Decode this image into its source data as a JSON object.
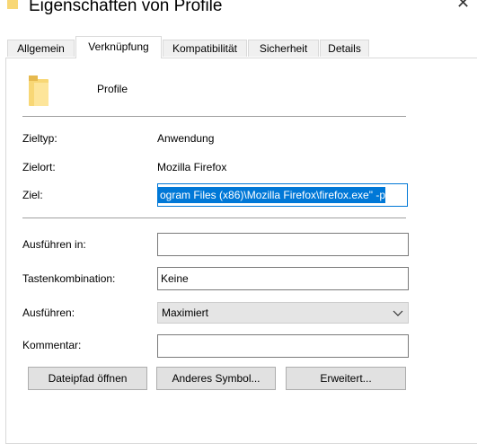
{
  "window": {
    "title": "Eigenschaften von Profile",
    "close_glyph": "✕"
  },
  "tabs": [
    {
      "label": "Allgemein",
      "active": false
    },
    {
      "label": "Verknüpfung",
      "active": true
    },
    {
      "label": "Kompatibilität",
      "active": false
    },
    {
      "label": "Sicherheit",
      "active": false
    },
    {
      "label": "Details",
      "active": false
    }
  ],
  "shortcut": {
    "name": "Profile",
    "icon": "folder-icon",
    "target_type_label": "Zieltyp:",
    "target_type_value": "Anwendung",
    "target_location_label": "Zielort:",
    "target_location_value": "Mozilla Firefox",
    "target_label": "Ziel:",
    "target_value": "ogram Files (x86)\\Mozilla Firefox\\firefox.exe\" -p",
    "start_in_label": "Ausführen in:",
    "start_in_value": "",
    "hotkey_label": "Tastenkombination:",
    "hotkey_value": "Keine",
    "run_label": "Ausführen:",
    "run_value": "Maximiert",
    "comment_label": "Kommentar:",
    "comment_value": ""
  },
  "buttons": {
    "open_location": "Dateipfad öffnen",
    "change_icon": "Anderes Symbol...",
    "advanced": "Erweitert..."
  },
  "colors": {
    "selection": "#0078d7",
    "folder": "#f8d775"
  }
}
